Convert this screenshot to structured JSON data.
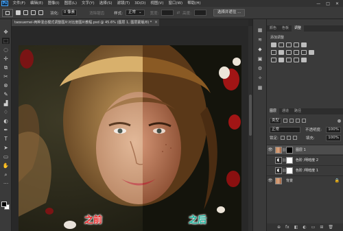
{
  "app": {
    "logo": "Ps",
    "menu": [
      "文件(F)",
      "编辑(E)",
      "图像(I)",
      "图层(L)",
      "文字(Y)",
      "选择(S)",
      "滤镜(T)",
      "3D(D)",
      "视图(V)",
      "窗口(W)",
      "帮助(H)"
    ],
    "window_controls": [
      "—",
      "□",
      "✕"
    ]
  },
  "options_bar": {
    "feather_label": "羽化:",
    "feather_value": "0 像素",
    "antialias_label": "消除锯齿",
    "style_label": "样式:",
    "style_value": "正常",
    "width_label": "宽度:",
    "swap_icon": "⇄",
    "height_label": "高度:",
    "select_mask_button": "选择并遮住 ..."
  },
  "document": {
    "tab_title": "taoxuemei-两种混合模式调整图片对比度图片教程.psd @ 45.6% (图层 1, 图层蒙版/8) *",
    "close_glyph": "×",
    "before_caption": "之前",
    "after_caption": "之后"
  },
  "tools": [
    "✥",
    "⬚",
    "◌",
    "✢",
    "⧉",
    "✂",
    "⊗",
    "✎",
    "▟",
    "♢",
    "◐",
    "✒",
    "T",
    "➤",
    "▭",
    "✋",
    "⌕",
    "⋯"
  ],
  "right_panel": {
    "top_tabs": [
      "颜色",
      "色板",
      "调整"
    ],
    "active_top_tab": "调整",
    "adjust_title": "添加调整",
    "layer_tabs": [
      "图层",
      "通道",
      "路径"
    ],
    "active_layer_tab": "图层",
    "filter_kind": "类型",
    "blend_mode": "正常",
    "opacity_label": "不透明度:",
    "opacity_value": "100%",
    "lock_label": "锁定:",
    "fill_label": "填充:",
    "fill_value": "100%",
    "layers": [
      {
        "name": "图层 1",
        "visible": true,
        "selected": true,
        "thumb": "photo",
        "mask": "black"
      },
      {
        "name": "色阶 /明暗度 2",
        "visible": false,
        "selected": false,
        "thumb": "adj",
        "mask": "white"
      },
      {
        "name": "色阶 /明暗度 1",
        "visible": false,
        "selected": false,
        "thumb": "adj",
        "mask": "white"
      },
      {
        "name": "背景",
        "visible": true,
        "selected": false,
        "thumb": "photo",
        "mask": "none",
        "locked": true
      }
    ],
    "footer_icons": [
      "⊕",
      "fx",
      "◧",
      "◐",
      "▭",
      "⊞",
      "🗑"
    ]
  },
  "strip_icons": [
    "▦",
    "≋",
    "◆",
    "▣",
    "⚙",
    "✧",
    "▦"
  ]
}
